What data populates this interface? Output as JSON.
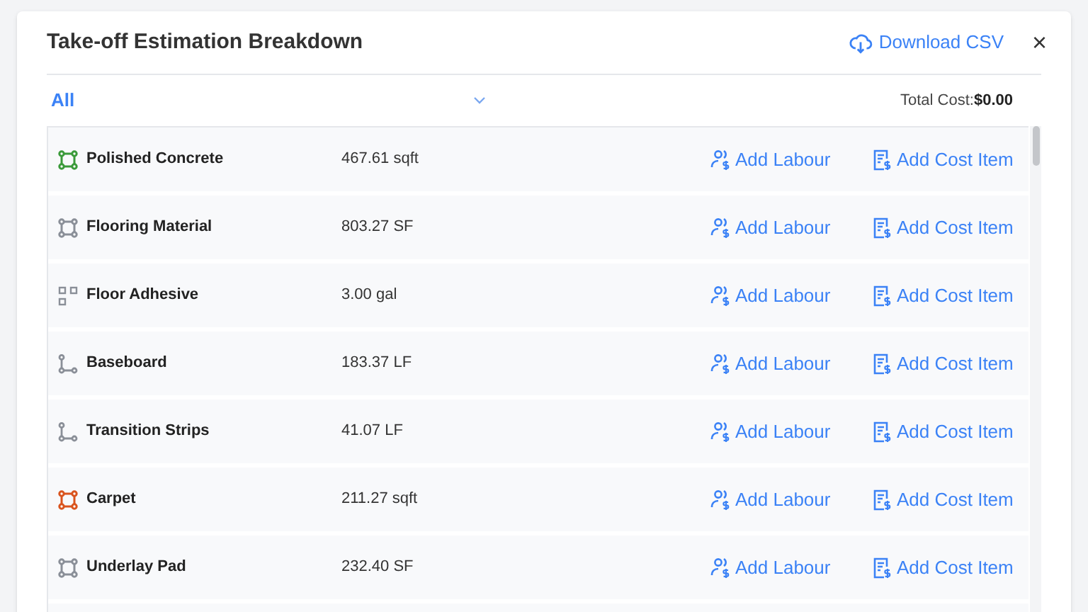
{
  "title": "Take-off Estimation Breakdown",
  "download": "Download CSV",
  "close": "×",
  "filter": {
    "value": "All"
  },
  "total": {
    "label": "Total Cost:",
    "value": "$0.00"
  },
  "rows": [
    {
      "kind": "area",
      "color": "#3a9a3a",
      "name": "Polished Concrete",
      "quantity": "467.61 sqft",
      "labour": "Add Labour",
      "cost": "Add Cost Item"
    },
    {
      "kind": "area",
      "color": "#8a8f98",
      "name": "Flooring Material",
      "quantity": "803.27 SF",
      "labour": "Add Labour",
      "cost": "Add Cost Item"
    },
    {
      "kind": "count",
      "color": "#8a8f98",
      "name": "Floor Adhesive",
      "quantity": "3.00 gal",
      "labour": "Add Labour",
      "cost": "Add Cost Item"
    },
    {
      "kind": "linear",
      "color": "#8a8f98",
      "name": "Baseboard",
      "quantity": "183.37 LF",
      "labour": "Add Labour",
      "cost": "Add Cost Item"
    },
    {
      "kind": "linear",
      "color": "#8a8f98",
      "name": "Transition Strips",
      "quantity": "41.07 LF",
      "labour": "Add Labour",
      "cost": "Add Cost Item"
    },
    {
      "kind": "area",
      "color": "#d9541e",
      "name": "Carpet",
      "quantity": "211.27 sqft",
      "labour": "Add Labour",
      "cost": "Add Cost Item"
    },
    {
      "kind": "area",
      "color": "#8a8f98",
      "name": "Underlay Pad",
      "quantity": "232.40 SF",
      "labour": "Add Labour",
      "cost": "Add Cost Item"
    }
  ]
}
